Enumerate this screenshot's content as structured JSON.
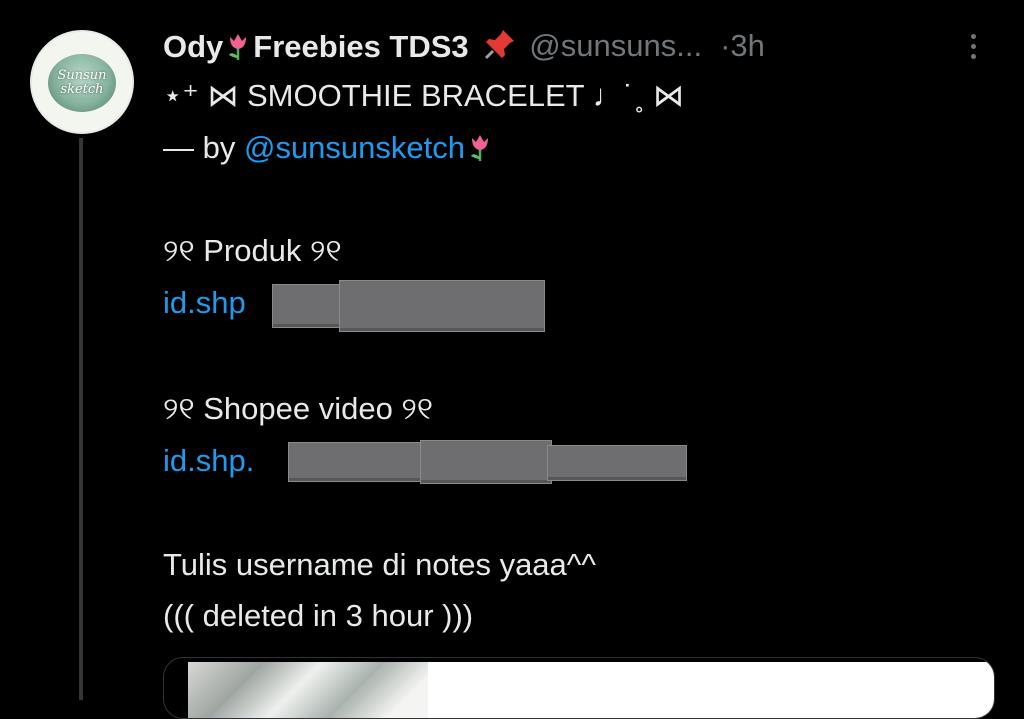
{
  "avatar": {
    "line1": "Sunsun",
    "line2": "sketch"
  },
  "tweet": {
    "display_name_part1": "Ody",
    "display_name_part2": "Freebies TDS3",
    "handle": "@sunsuns...",
    "separator": "·",
    "time": "3h",
    "lines": {
      "title": "⋆⁺ ⋈ SMOOTHIE BRACELET ♩˙˳ ⋈",
      "by_prefix": "— by ",
      "by_handle": "@sunsunsketch",
      "produk_label": "୨୧ Produk ୨୧",
      "produk_link": "id.shp",
      "video_label": "୨୧ Shopee video ୨୧",
      "video_link": "id.shp.",
      "notes": "Tulis username di notes yaaa^^",
      "deleted": "((( deleted in 3 hour )))"
    }
  },
  "icons": {
    "tulip": "tulip-icon",
    "pin": "pushpin-icon",
    "more": "more-options-icon"
  },
  "colors": {
    "background": "#000000",
    "text": "#e7e9ea",
    "muted": "#71767b",
    "link": "#1d9bf0"
  }
}
